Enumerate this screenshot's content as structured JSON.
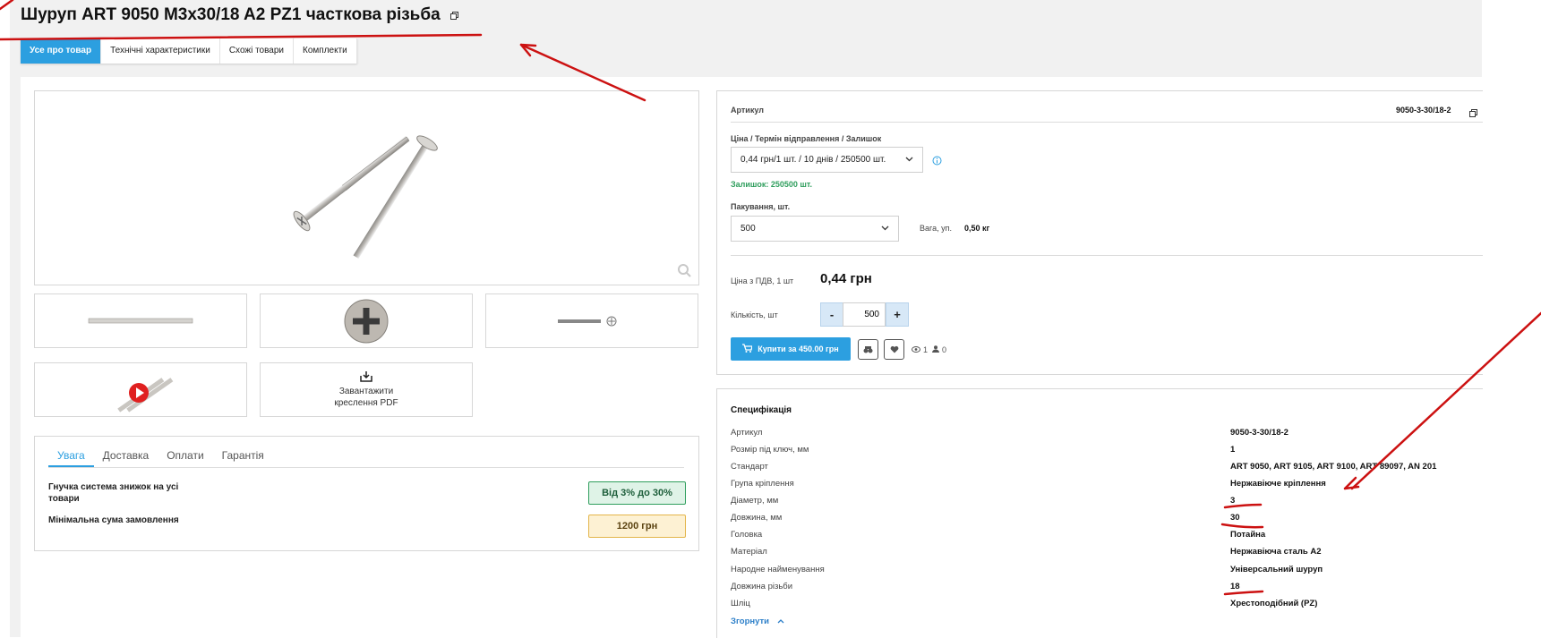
{
  "product": {
    "title": "Шуруп ART 9050 M3x30/18 A2 PZ1 часткова різьба"
  },
  "tabs": [
    {
      "label": "Усе про товар",
      "active": true
    },
    {
      "label": "Технічні характеристики"
    },
    {
      "label": "Схожі товари"
    },
    {
      "label": "Комплекти"
    }
  ],
  "gallery": {
    "pdf_line1": "Завантажити",
    "pdf_line2": "креслення PDF"
  },
  "info": {
    "tabs": [
      "Увага",
      "Доставка",
      "Оплати",
      "Гарантія"
    ],
    "discount_label": "Гнучка система знижок на усі товари",
    "discount_badge": "Від 3% до 30%",
    "min_order_label": "Мінімальна сума замовлення",
    "min_order_badge": "1200 грн"
  },
  "buy": {
    "sku_label": "Артикул",
    "sku_value": "9050-3-30/18-2",
    "price_term_label": "Ціна / Термін відправлення / Залишок",
    "price_term_value": "0,44 грн/1 шт. / 10 днів / 250500 шт.",
    "stock_text": "Залишок: 250500 шт.",
    "packing_label": "Пакування, шт.",
    "packing_value": "500",
    "weight_label": "Вага, уп.",
    "weight_value": "0,50 кг",
    "price_label": "Ціна з ПДВ, 1 шт",
    "price_value": "0,44 грн",
    "qty_label": "Кількість, шт",
    "qty_minus": "-",
    "qty_value": "500",
    "qty_plus": "+",
    "buy_button": "Купити за 450.00 грн",
    "views": "1",
    "users": "0"
  },
  "spec": {
    "title": "Специфікація",
    "rows": [
      {
        "k": "Артикул",
        "v": "9050-3-30/18-2"
      },
      {
        "k": "Розмір під ключ, мм",
        "v": "1"
      },
      {
        "k": "Стандарт",
        "v": "ART 9050, ART 9105, ART 9100, ART 89097, AN 201"
      },
      {
        "k": "Група кріплення",
        "v": "Нержавіюче кріплення"
      },
      {
        "k": "Діаметр, мм",
        "v": "3"
      },
      {
        "k": "Довжина, мм",
        "v": "30"
      },
      {
        "k": "Головка",
        "v": "Потайна"
      },
      {
        "k": "Матеріал",
        "v": "Нержавіюча сталь А2"
      },
      {
        "k": "Народне найменування",
        "v": "Універсальний шуруп"
      },
      {
        "k": "Довжина різьби",
        "v": "18"
      },
      {
        "k": "Шліц",
        "v": "Хрестоподібний (PZ)"
      }
    ],
    "collapse": "Згорнути"
  },
  "colors": {
    "accent": "#2c9fe0",
    "annotation": "#cc1111",
    "stock_green": "#2f9e5d"
  }
}
